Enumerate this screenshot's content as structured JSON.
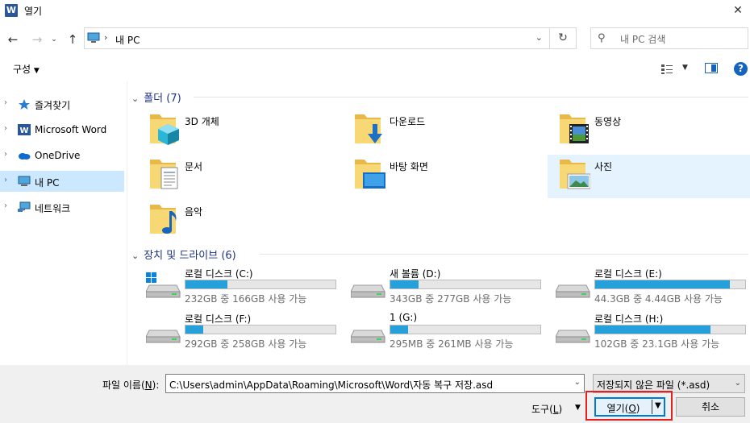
{
  "window": {
    "title": "열기",
    "close_icon": "close-icon"
  },
  "nav": {
    "address": "내 PC",
    "search_placeholder": "내 PC 검색"
  },
  "toolbar": {
    "organize_label": "구성"
  },
  "sidebar": {
    "items": [
      {
        "label": "즐겨찾기",
        "icon": "star-icon"
      },
      {
        "label": "Microsoft Word",
        "icon": "word-icon"
      },
      {
        "label": "OneDrive",
        "icon": "cloud-icon"
      },
      {
        "label": "내 PC",
        "icon": "pc-icon",
        "selected": true
      },
      {
        "label": "네트워크",
        "icon": "network-icon"
      }
    ]
  },
  "folders": {
    "header": "폴더 (7)",
    "items": [
      {
        "label": "3D 개체",
        "icon": "3d-objects-folder-icon"
      },
      {
        "label": "다운로드",
        "icon": "downloads-folder-icon"
      },
      {
        "label": "동영상",
        "icon": "videos-folder-icon"
      },
      {
        "label": "문서",
        "icon": "documents-folder-icon"
      },
      {
        "label": "바탕 화면",
        "icon": "desktop-folder-icon"
      },
      {
        "label": "사진",
        "icon": "pictures-folder-icon",
        "selected": true
      },
      {
        "label": "음악",
        "icon": "music-folder-icon"
      }
    ]
  },
  "drives": {
    "header": "장치 및 드라이브 (6)",
    "items": [
      {
        "label": "로컬 디스크 (C:)",
        "free": "232GB 중 166GB 사용 가능",
        "used_fraction": 0.28,
        "system": true
      },
      {
        "label": "새 볼륨 (D:)",
        "free": "343GB 중 277GB 사용 가능",
        "used_fraction": 0.19
      },
      {
        "label": "로컬 디스크 (E:)",
        "free": "44.3GB 중 4.44GB 사용 가능",
        "used_fraction": 0.9
      },
      {
        "label": "로컬 디스크 (F:)",
        "free": "292GB 중 258GB 사용 가능",
        "used_fraction": 0.12
      },
      {
        "label": "1 (G:)",
        "free": "295MB 중 261MB 사용 가능",
        "used_fraction": 0.12
      },
      {
        "label": "로컬 디스크 (H:)",
        "free": "102GB 중 23.1GB 사용 가능",
        "used_fraction": 0.77
      }
    ]
  },
  "footer": {
    "filename_label_pre": "파일 이름(",
    "filename_label_key": "N",
    "filename_label_post": "):",
    "filename_value": "C:\\Users\\admin\\AppData\\Roaming\\Microsoft\\Word\\자동 복구 저장.asd",
    "filetype_value": "저장되지 않은 파일 (*.asd)",
    "tools_pre": "도구(",
    "tools_key": "L",
    "tools_post": ")",
    "open_pre": "열기(",
    "open_key": "O",
    "open_post": ")",
    "cancel_label": "취소"
  },
  "colors": {
    "accent": "#0078d7",
    "bar": "#26a0da",
    "highlight": "#e52020",
    "selected": "#cce8ff"
  }
}
